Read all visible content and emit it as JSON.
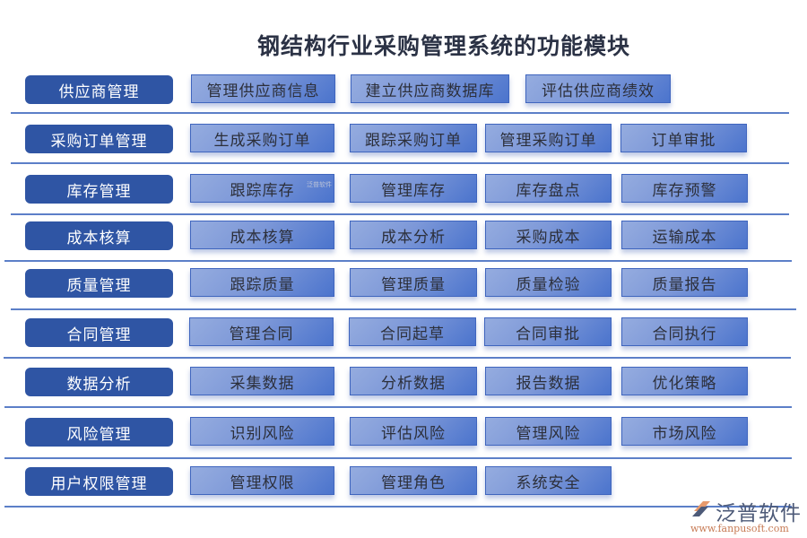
{
  "title": "钢结构行业采购管理系统的功能模块",
  "modules": [
    {
      "name": "供应商管理",
      "items": [
        "管理供应商信息",
        "建立供应商数据库",
        "评估供应商绩效"
      ]
    },
    {
      "name": "采购订单管理",
      "items": [
        "生成采购订单",
        "跟踪采购订单",
        "管理采购订单",
        "订单审批"
      ]
    },
    {
      "name": "库存管理",
      "items": [
        "跟踪库存",
        "管理库存",
        "库存盘点",
        "库存预警"
      ]
    },
    {
      "name": "成本核算",
      "items": [
        "成本核算",
        "成本分析",
        "采购成本",
        "运输成本"
      ]
    },
    {
      "name": "质量管理",
      "items": [
        "跟踪质量",
        "管理质量",
        "质量检验",
        "质量报告"
      ]
    },
    {
      "name": "合同管理",
      "items": [
        "管理合同",
        "合同起草",
        "合同审批",
        "合同执行"
      ]
    },
    {
      "name": "数据分析",
      "items": [
        "采集数据",
        "分析数据",
        "报告数据",
        "优化策略"
      ]
    },
    {
      "name": "风险管理",
      "items": [
        "识别风险",
        "评估风险",
        "管理风险",
        "市场风险"
      ]
    },
    {
      "name": "用户权限管理",
      "items": [
        "管理权限",
        "管理角色",
        "系统安全"
      ]
    }
  ],
  "logo": {
    "name": "泛普软件",
    "url": "www.fanpusoft.com",
    "watermark": "泛普软件"
  },
  "colors": {
    "category": "#2f55a4",
    "item_start": "#95acdf",
    "item_end": "#4b74cd",
    "separator": "#5c7fc8"
  }
}
